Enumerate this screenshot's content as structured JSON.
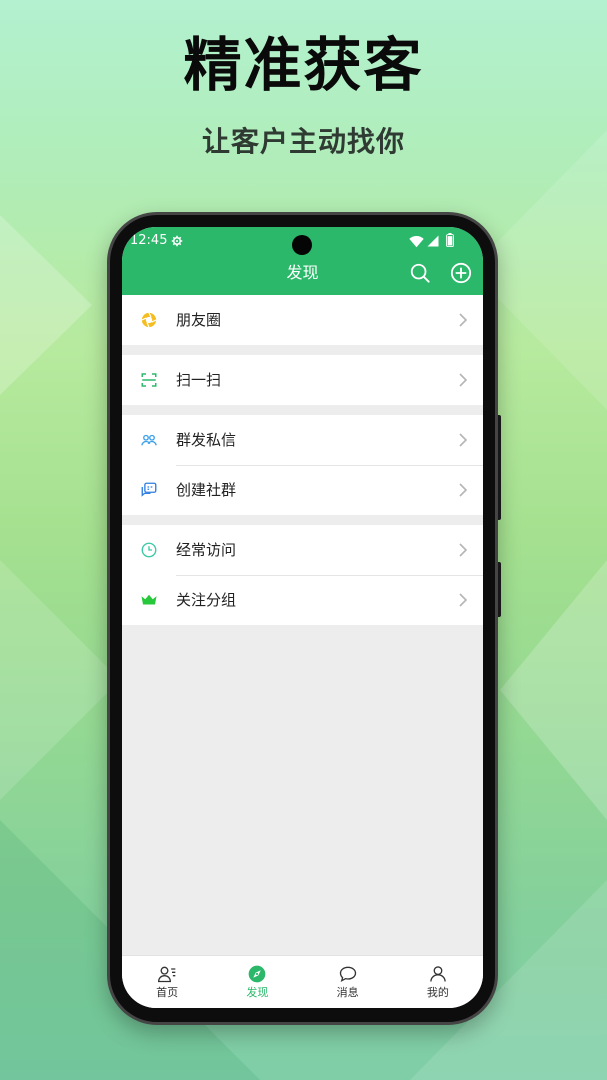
{
  "promo": {
    "headline": "精准获客",
    "subheadline": "让客户主动找你"
  },
  "status_bar": {
    "time": "12:45",
    "left_icons": [
      "settings-icon"
    ],
    "right_icons": [
      "wifi-icon",
      "signal-icon",
      "battery-icon"
    ]
  },
  "header": {
    "title": "发现",
    "actions": [
      "search-icon",
      "add-circle-icon"
    ]
  },
  "menu": {
    "groups": [
      {
        "items": [
          {
            "label": "朋友圈",
            "icon": "moments-icon",
            "icon_color": "#f5bd1f"
          }
        ]
      },
      {
        "items": [
          {
            "label": "扫一扫",
            "icon": "scan-icon",
            "icon_color": "#2cb86b"
          }
        ]
      },
      {
        "items": [
          {
            "label": "群发私信",
            "icon": "group-message-icon",
            "icon_color": "#3aa0ea"
          },
          {
            "label": "创建社群",
            "icon": "create-community-icon",
            "icon_color": "#2f7fe0"
          }
        ]
      },
      {
        "items": [
          {
            "label": "经常访问",
            "icon": "clock-icon",
            "icon_color": "#3cc9a4"
          },
          {
            "label": "关注分组",
            "icon": "crown-icon",
            "icon_color": "#28c83c"
          }
        ]
      }
    ]
  },
  "bottom_nav": {
    "items": [
      {
        "label": "首页",
        "icon": "contacts-icon",
        "active": false
      },
      {
        "label": "发现",
        "icon": "compass-icon",
        "active": true
      },
      {
        "label": "消息",
        "icon": "chat-icon",
        "active": false
      },
      {
        "label": "我的",
        "icon": "profile-icon",
        "active": false
      }
    ]
  },
  "colors": {
    "brand_green": "#2cb86b",
    "content_background": "#ededed",
    "text_primary": "#222222",
    "chevron": "#b5b5b5"
  }
}
